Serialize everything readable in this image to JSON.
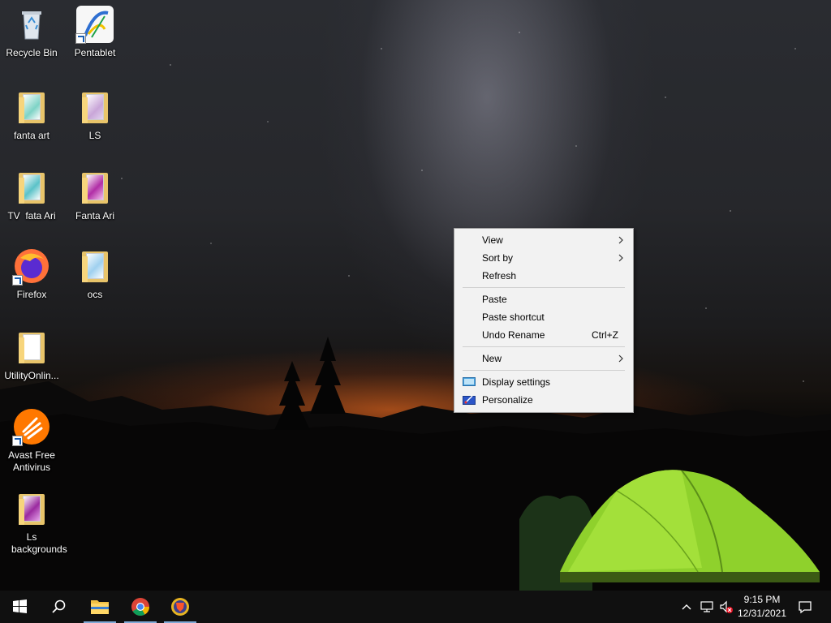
{
  "desktop": {
    "icons": [
      {
        "label": "Recycle Bin",
        "icon": "recycle-bin-icon"
      },
      {
        "label": "Pentablet",
        "icon": "pentablet-app-icon"
      },
      {
        "label": "fanta art",
        "icon": "folder-icon"
      },
      {
        "label": "LS",
        "icon": "folder-icon"
      },
      {
        "label": "TV  fata Ari",
        "icon": "folder-icon"
      },
      {
        "label": "Fanta Ari",
        "icon": "folder-icon"
      },
      {
        "label": "Firefox",
        "icon": "firefox-icon"
      },
      {
        "label": "ocs",
        "icon": "folder-icon"
      },
      {
        "label": "UtilityOnlin...",
        "icon": "folder-icon"
      },
      {
        "label": "Avast Free Antivirus",
        "icon": "avast-icon"
      },
      {
        "label": "Ls backgrounds",
        "icon": "folder-icon"
      }
    ]
  },
  "context_menu": {
    "items": [
      {
        "label": "View",
        "submenu": true
      },
      {
        "label": "Sort by",
        "submenu": true
      },
      {
        "label": "Refresh"
      },
      {
        "label": "Paste"
      },
      {
        "label": "Paste shortcut"
      },
      {
        "label": "Undo Rename",
        "shortcut": "Ctrl+Z"
      },
      {
        "label": "New",
        "submenu": true
      },
      {
        "label": "Display settings",
        "icon": "display-settings-icon"
      },
      {
        "label": "Personalize",
        "icon": "personalize-icon"
      }
    ]
  },
  "taskbar": {
    "buttons": [
      {
        "name": "start",
        "icon": "windows-start-icon"
      },
      {
        "name": "search",
        "icon": "search-icon"
      },
      {
        "name": "file-explorer",
        "icon": "file-explorer-icon"
      },
      {
        "name": "chrome",
        "icon": "chrome-icon"
      },
      {
        "name": "brave",
        "icon": "brave-icon"
      }
    ],
    "tray": {
      "time": "9:15 PM",
      "date": "12/31/2021"
    }
  },
  "colors": {
    "taskbar": "#101010",
    "menu_background": "#f2f2f2",
    "tent": "#8fd12c",
    "active_indicator": "#7fa9d6"
  }
}
